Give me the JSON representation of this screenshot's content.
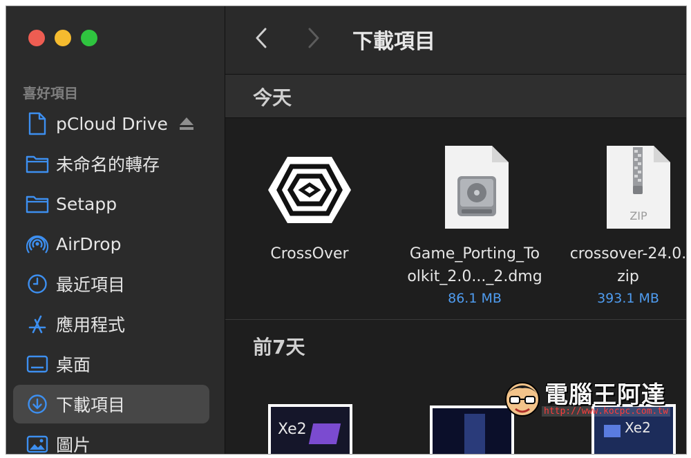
{
  "sidebar": {
    "section_label": "喜好項目",
    "items": [
      {
        "label": "pCloud Drive",
        "icon": "document-icon"
      },
      {
        "label": "未命名的轉存",
        "icon": "folder-icon"
      },
      {
        "label": "Setapp",
        "icon": "folder-icon"
      },
      {
        "label": "AirDrop",
        "icon": "airdrop-icon"
      },
      {
        "label": "最近項目",
        "icon": "clock-icon"
      },
      {
        "label": "應用程式",
        "icon": "applications-icon"
      },
      {
        "label": "桌面",
        "icon": "desktop-icon"
      },
      {
        "label": "下載項目",
        "icon": "download-icon",
        "selected": true
      },
      {
        "label": "圖片",
        "icon": "photos-icon"
      }
    ]
  },
  "toolbar": {
    "title": "下載項目"
  },
  "groups": [
    {
      "header": "今天",
      "files": [
        {
          "name_line1": "CrossOver",
          "name_line2": "",
          "size": "",
          "icon": "crossover-app-icon"
        },
        {
          "name_line1": "Game_Porting_To",
          "name_line2": "olkit_2.0..._2.dmg",
          "size": "86.1 MB",
          "icon": "disk-image-icon"
        },
        {
          "name_line1": "crossover-24.0.",
          "name_line2": "zip",
          "size": "393.1 MB",
          "icon": "zip-file-icon",
          "icon_text": "ZIP"
        }
      ]
    },
    {
      "header": "前7天",
      "thumbnails": [
        {
          "text": "Xe2",
          "icon": "image-thumbnail-icon"
        },
        {
          "text": "",
          "icon": "image-thumbnail-icon"
        },
        {
          "text": "Xe2",
          "icon": "image-thumbnail-icon"
        }
      ]
    }
  ],
  "watermark": {
    "title": "電腦王阿達",
    "url": "http://www.kocpc.com.tw"
  },
  "colors": {
    "accent": "#4f9cf0",
    "sidebar_bg": "#2b2b2b",
    "main_bg": "#1e1e1e",
    "selected_bg": "#474747"
  }
}
